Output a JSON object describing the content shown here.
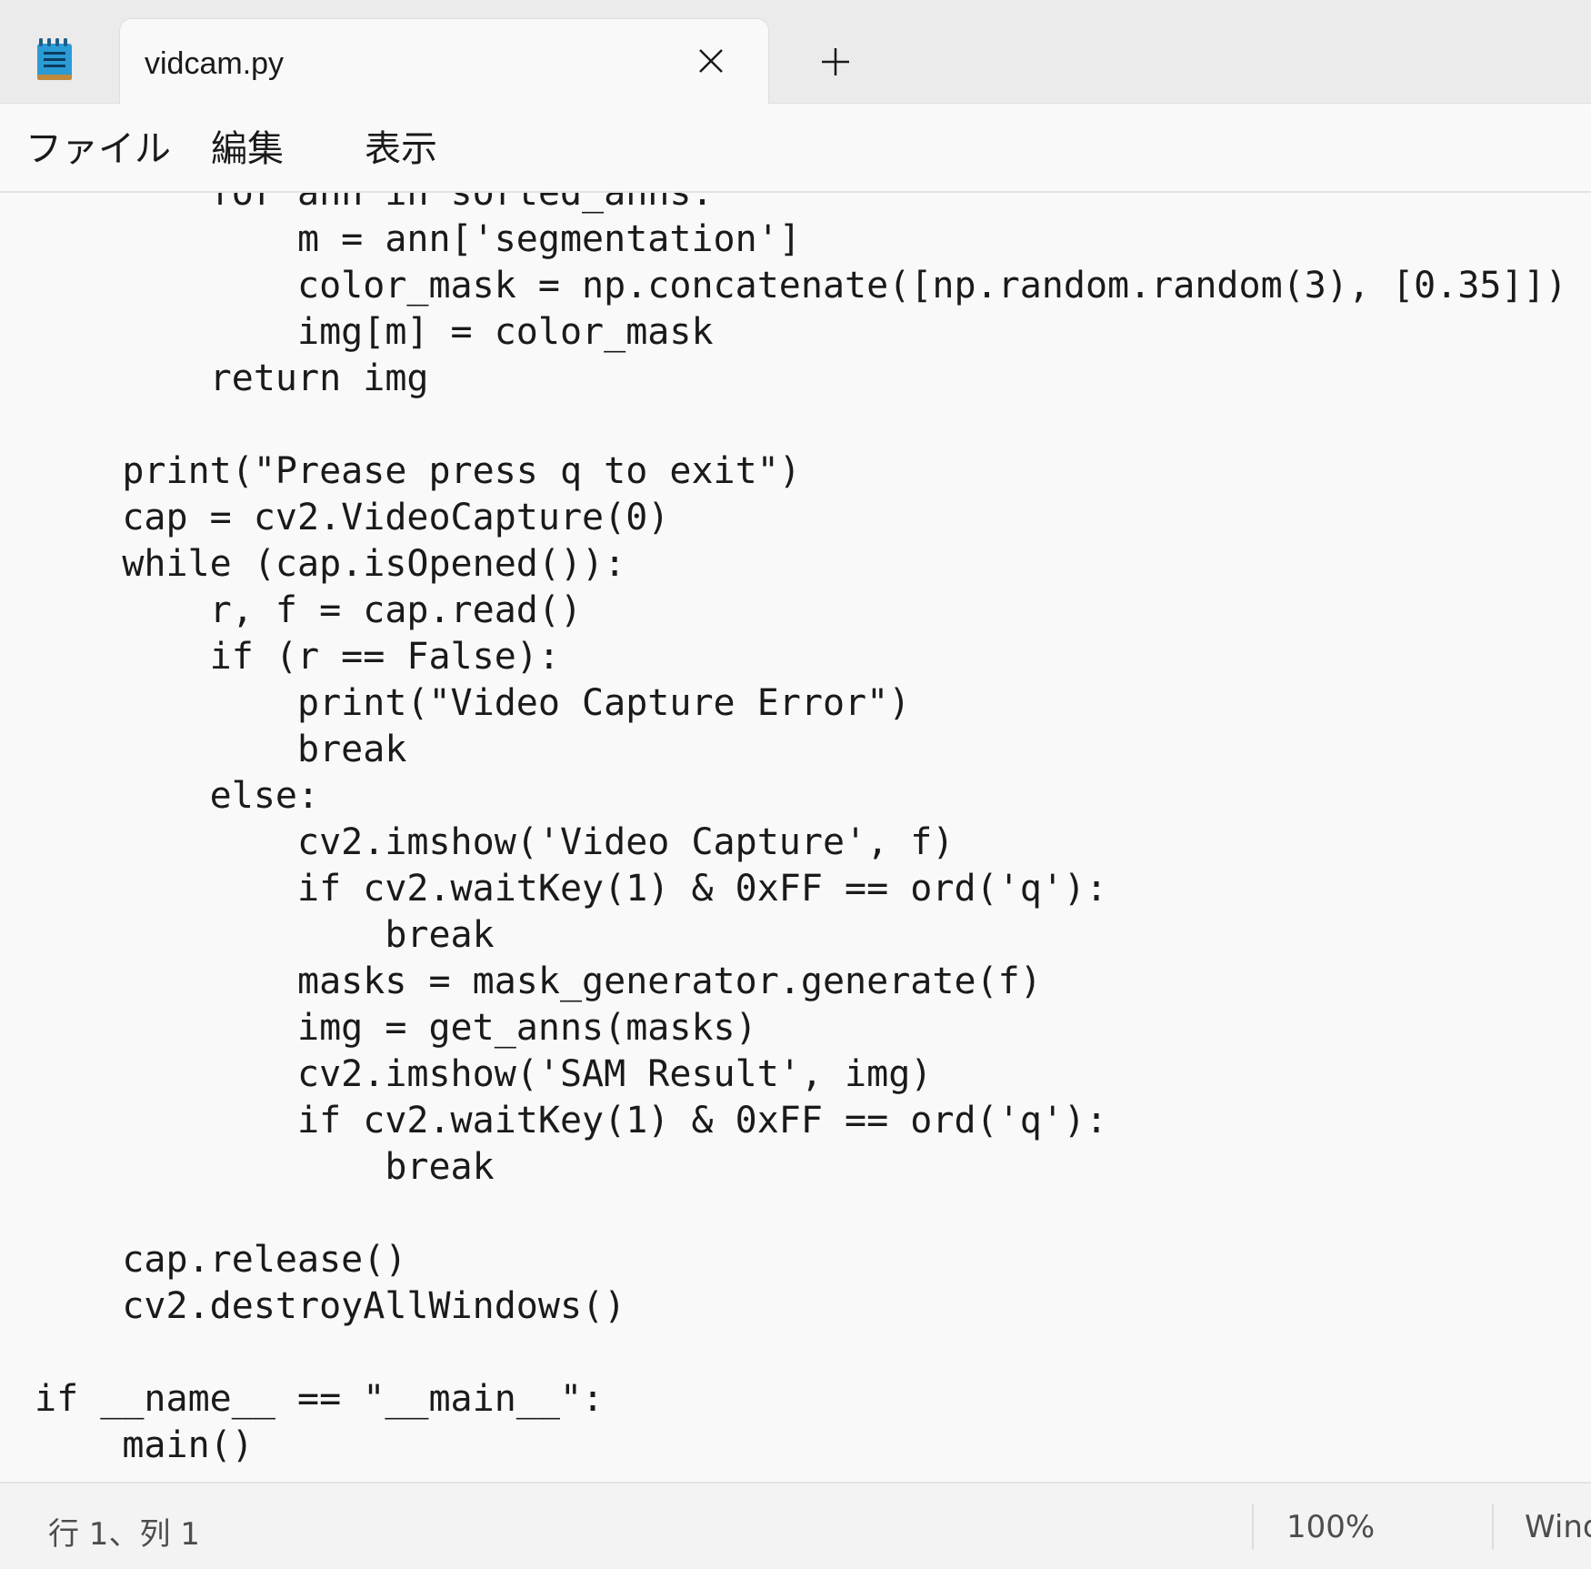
{
  "tab": {
    "title": "vidcam.py"
  },
  "icons": {
    "app": "notepad-icon",
    "close": "close-icon",
    "new_tab": "plus-icon"
  },
  "menu": {
    "file": "ファイル",
    "edit": "編集",
    "view": "表示"
  },
  "editor": {
    "lines": [
      "    for ann in sorted_anns:",
      "        m = ann['segmentation']",
      "        color_mask = np.concatenate([np.random.random(3), [0.35]])",
      "        img[m] = color_mask",
      "    return img",
      "",
      "print(\"Prease press q to exit\")",
      "cap = cv2.VideoCapture(0)",
      "while (cap.isOpened()):",
      "    r, f = cap.read()",
      "    if (r == False):",
      "        print(\"Video Capture Error\")",
      "        break",
      "    else:",
      "        cv2.imshow('Video Capture', f)",
      "        if cv2.waitKey(1) & 0xFF == ord('q'):",
      "            break",
      "        masks = mask_generator.generate(f)",
      "        img = get_anns(masks)",
      "        cv2.imshow('SAM Result', img)",
      "        if cv2.waitKey(1) & 0xFF == ord('q'):",
      "            break",
      "",
      "cap.release()",
      "cv2.destroyAllWindows()",
      "",
      "if __name__ == \"__main__\":",
      "    main()"
    ],
    "indents": [
      2,
      2,
      2,
      2,
      2,
      0,
      1,
      1,
      1,
      1,
      1,
      1,
      1,
      1,
      1,
      1,
      1,
      1,
      1,
      1,
      1,
      1,
      0,
      1,
      1,
      0,
      0,
      0
    ]
  },
  "status": {
    "position": "行 1、列 1",
    "zoom": "100%",
    "line_ending": "Windows (CRLF)"
  },
  "colors": {
    "background": "#f9f9f9",
    "tabbar": "#ebebeb",
    "text": "#1a1a1a",
    "icon_blue": "#2b9bd6"
  }
}
